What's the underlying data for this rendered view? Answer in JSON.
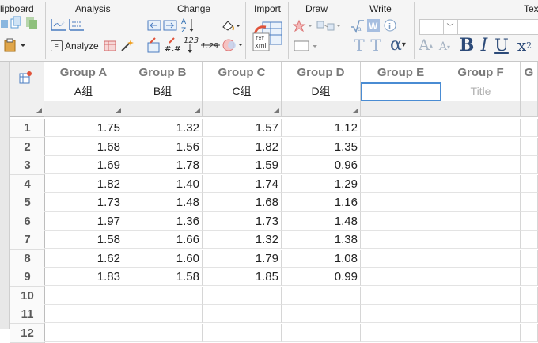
{
  "ribbon": {
    "sections": {
      "clipboard": "lipboard",
      "analysis": "Analysis",
      "change": "Change",
      "import": "Import",
      "draw": "Draw",
      "write": "Write",
      "text": "Tex"
    },
    "analyze_label": "Analyze",
    "import_icon_text": "txt\nxml",
    "change_icon_text_123": "123",
    "change_icon_text_129": "1.29",
    "change_icon_text_hash": "#.#",
    "write_greek": "α",
    "text_buttons": [
      "A",
      "A",
      "B",
      "I",
      "U",
      "x²"
    ]
  },
  "table": {
    "columns": [
      {
        "header": "Group A",
        "subtitle": "A组"
      },
      {
        "header": "Group B",
        "subtitle": "B组"
      },
      {
        "header": "Group C",
        "subtitle": "C组"
      },
      {
        "header": "Group D",
        "subtitle": "D组"
      },
      {
        "header": "Group E",
        "subtitle": ""
      },
      {
        "header": "Group F",
        "subtitle": "Title"
      },
      {
        "header": "G",
        "subtitle": ""
      }
    ],
    "row_numbers": [
      "1",
      "2",
      "3",
      "4",
      "5",
      "6",
      "7",
      "8",
      "9",
      "10",
      "11",
      "12"
    ],
    "rows": [
      [
        "1.75",
        "1.32",
        "1.57",
        "1.12"
      ],
      [
        "1.68",
        "1.56",
        "1.82",
        "1.35"
      ],
      [
        "1.69",
        "1.78",
        "1.59",
        "0.96"
      ],
      [
        "1.82",
        "1.40",
        "1.74",
        "1.29"
      ],
      [
        "1.73",
        "1.48",
        "1.68",
        "1.16"
      ],
      [
        "1.97",
        "1.36",
        "1.73",
        "1.48"
      ],
      [
        "1.58",
        "1.66",
        "1.32",
        "1.38"
      ],
      [
        "1.62",
        "1.60",
        "1.79",
        "1.08"
      ],
      [
        "1.83",
        "1.58",
        "1.85",
        "0.99"
      ],
      [
        "",
        "",
        "",
        ""
      ],
      [
        "",
        "",
        "",
        ""
      ],
      [
        "",
        "",
        "",
        ""
      ]
    ]
  },
  "colors": {
    "accent": "#4a8cd3",
    "header_text": "#7a7a7a"
  }
}
